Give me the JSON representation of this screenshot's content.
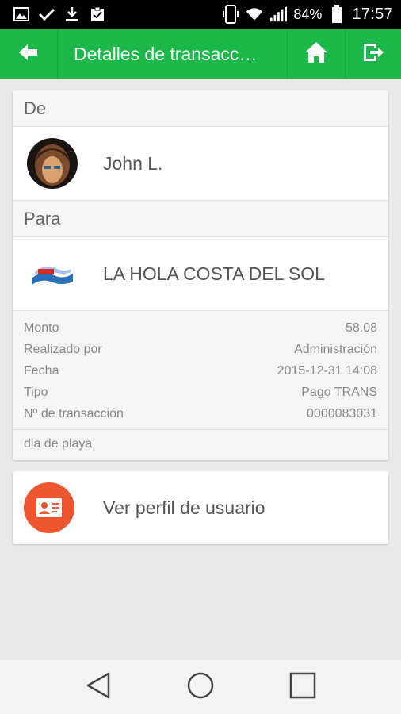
{
  "status_bar": {
    "icons_left": [
      "image-icon",
      "check-icon",
      "download-icon",
      "clipboard-icon"
    ],
    "icons_right": [
      "vibrate-icon",
      "wifi-icon",
      "signal-icon"
    ],
    "battery": "84%",
    "time": "17:57"
  },
  "app_bar": {
    "title": "Detalles de transacc…",
    "background": "#1cb94a"
  },
  "transaction": {
    "from_label": "De",
    "from_name": "John L.",
    "to_label": "Para",
    "to_name": "LA HOLA COSTA DEL SOL",
    "details": [
      {
        "label": "Monto",
        "value": "58.08"
      },
      {
        "label": "Realizado por",
        "value": "Administración"
      },
      {
        "label": "Fecha",
        "value": "2015-12-31 14:08"
      },
      {
        "label": "Tipo",
        "value": "Pago TRANS"
      },
      {
        "label": "Nº de transacción",
        "value": "0000083031"
      }
    ],
    "note": "dia de playa"
  },
  "profile_button": {
    "label": "Ver perfil de usuario",
    "icon_color": "#ee5630"
  },
  "nav_bar": {
    "buttons": [
      "back-triangle-icon",
      "home-circle-icon",
      "recents-square-icon"
    ]
  }
}
